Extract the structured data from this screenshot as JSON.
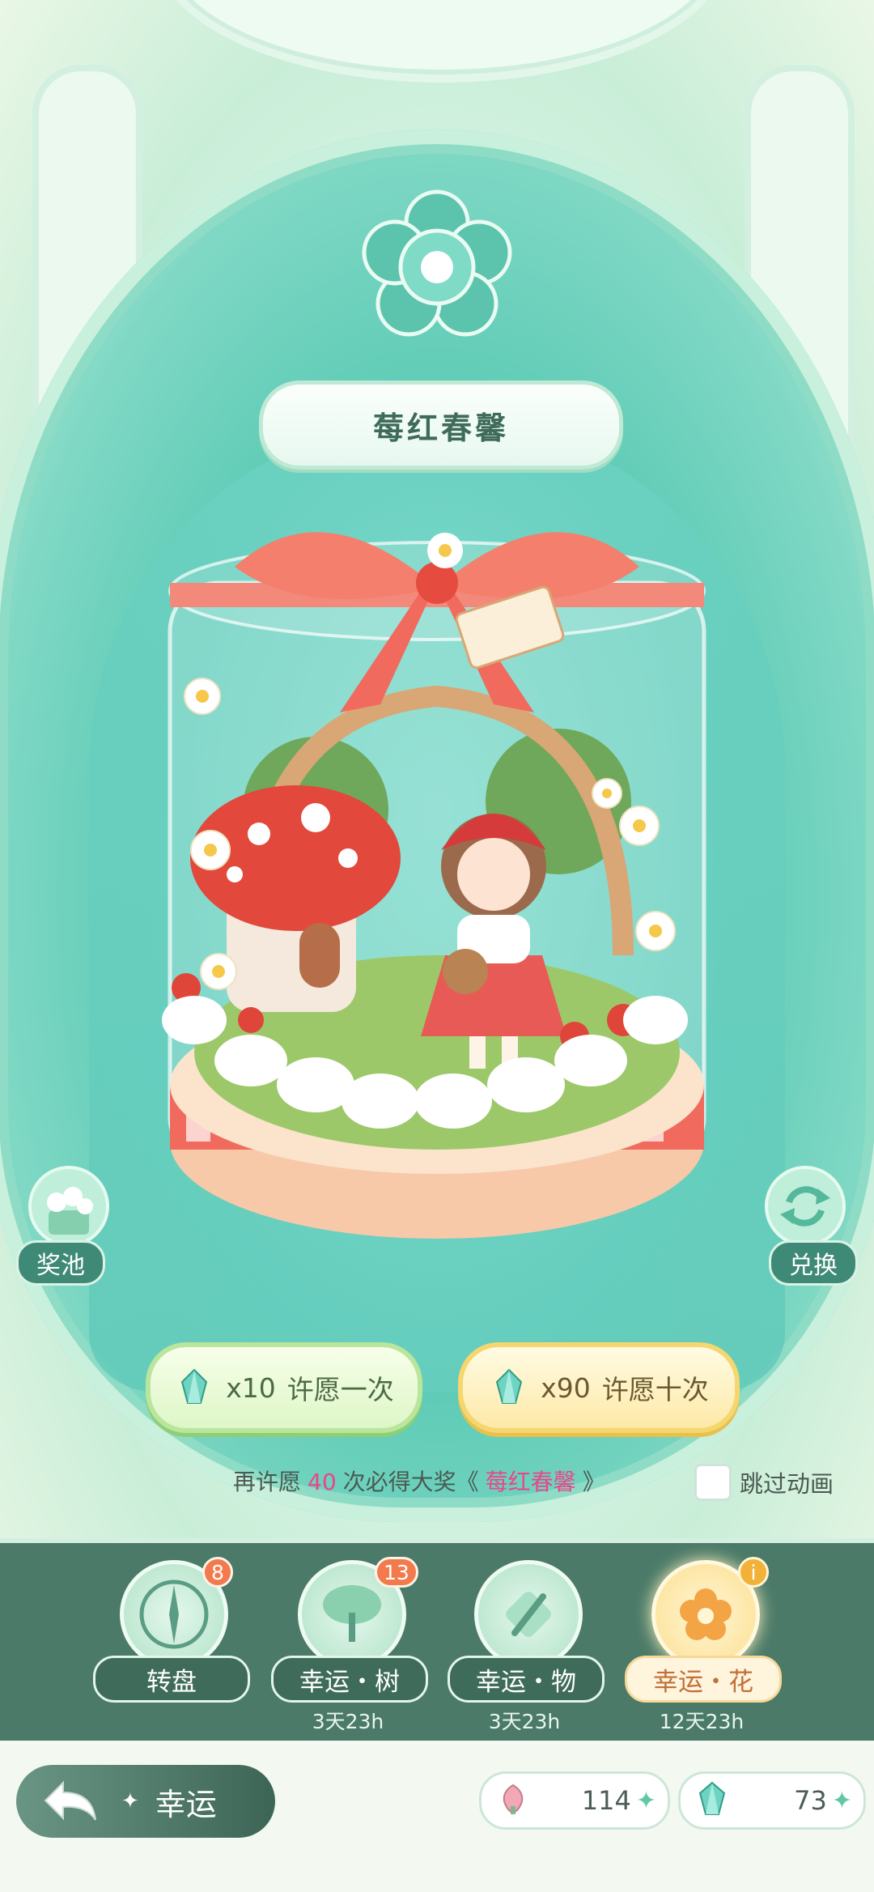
{
  "title": "莓红春馨",
  "side_buttons": {
    "pool_label": "奖池",
    "exchange_label": "兑换"
  },
  "wish": {
    "single_cost": "x10",
    "single_label": "许愿一次",
    "ten_cost": "x90",
    "ten_label": "许愿十次"
  },
  "guarantee": {
    "prefix": "再许愿",
    "count": "40",
    "middle": "次必得大奖《",
    "prize": "莓红春馨",
    "suffix": "》"
  },
  "skip_animation_label": "跳过动画",
  "tabs": [
    {
      "label": "转盘",
      "badge": "8",
      "timer": ""
    },
    {
      "label": "幸运・树",
      "badge": "13",
      "timer": "3天23h"
    },
    {
      "label": "幸运・物",
      "badge": "",
      "timer": "3天23h"
    },
    {
      "label": "幸运・花",
      "badge": "",
      "timer": "12天23h"
    }
  ],
  "footer": {
    "back_label": "幸运",
    "currency_flower": "114",
    "currency_gem": "73"
  },
  "colors": {
    "accent_teal": "#5ecbb6",
    "badge_orange": "#f27a4d",
    "highlight_pink": "#e8468a",
    "tabbar_green": "#4b7a68"
  }
}
